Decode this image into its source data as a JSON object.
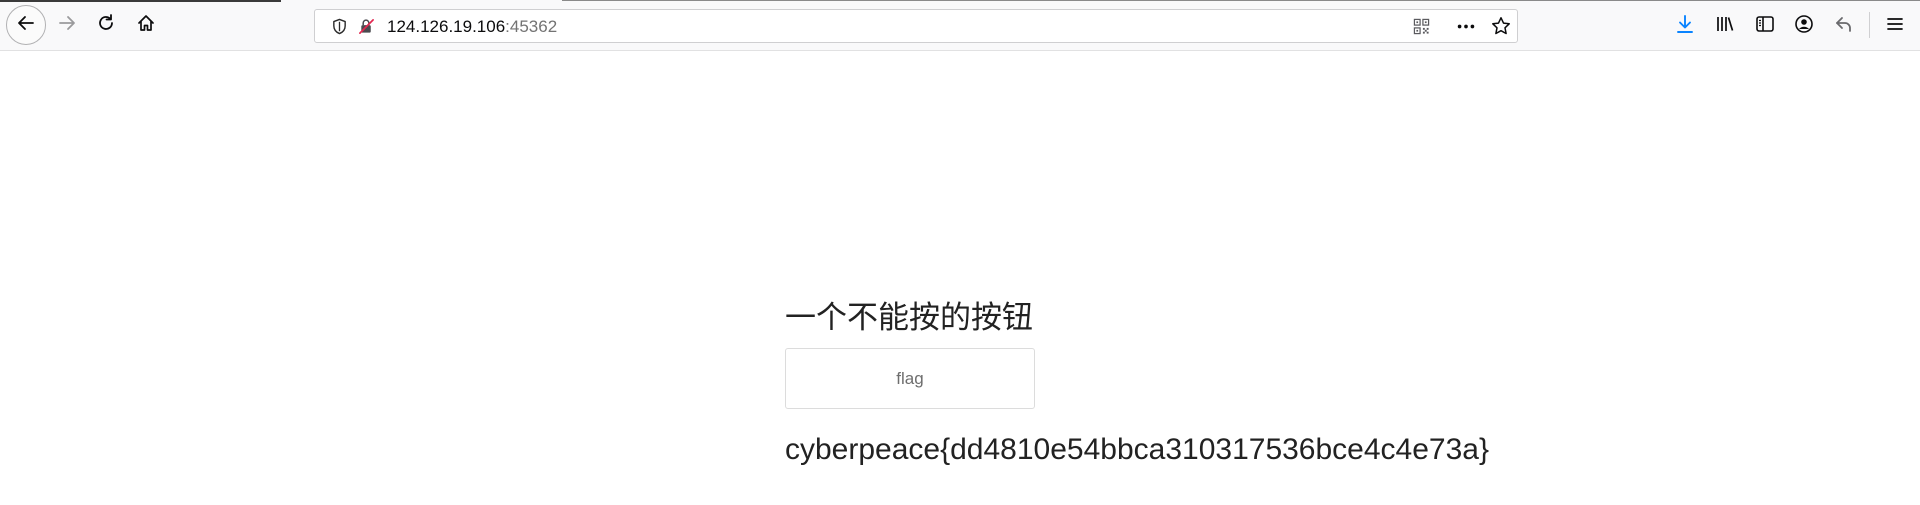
{
  "browser": {
    "url_host": "124.126.19.106",
    "url_port": ":45362",
    "icons": {
      "back": "back-arrow-icon",
      "forward": "forward-arrow-icon",
      "reload": "reload-icon",
      "home": "home-icon",
      "tracking": "shield-icon",
      "insecure": "insecure-lock-icon",
      "qr": "qr-code-icon",
      "page_actions": "more-dots-icon",
      "bookmark": "star-icon",
      "downloads": "download-icon",
      "library": "library-icon",
      "sidebar": "sidebar-icon",
      "account": "account-icon",
      "undo": "undo-icon",
      "menu": "hamburger-menu-icon"
    },
    "accent_color": "#0a84ff"
  },
  "page": {
    "title": "一个不能按的按钮",
    "button_label": "flag",
    "button_state": "disabled",
    "flag_text": "cyberpeace{dd4810e54bbca310317536bce4c4e73a}"
  }
}
